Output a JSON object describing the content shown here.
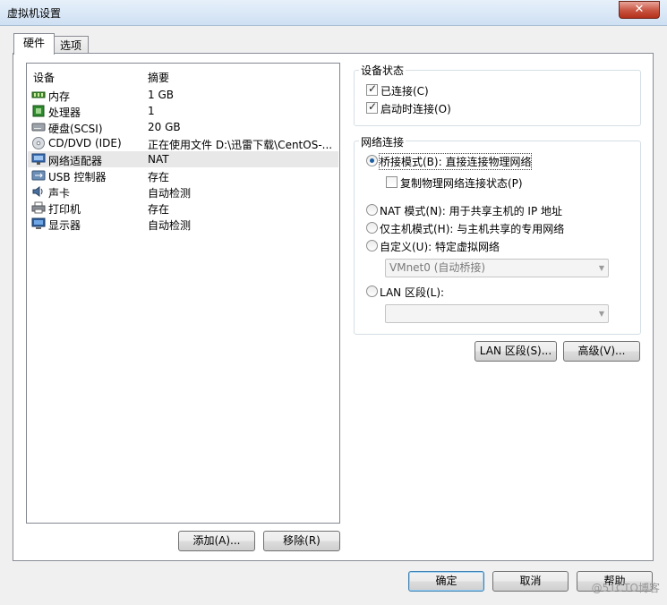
{
  "window": {
    "title": "虚拟机设置",
    "close_glyph": "✕"
  },
  "tabs": [
    {
      "label": "硬件"
    },
    {
      "label": "选项"
    }
  ],
  "device_list": {
    "col_device": "设备",
    "col_summary": "摘要",
    "rows": [
      {
        "name": "内存",
        "summary": "1 GB",
        "icon": "memory-icon"
      },
      {
        "name": "处理器",
        "summary": "1",
        "icon": "processor-icon"
      },
      {
        "name": "硬盘(SCSI)",
        "summary": "20 GB",
        "icon": "hard-disk-icon"
      },
      {
        "name": "CD/DVD (IDE)",
        "summary": "正在使用文件 D:\\迅雷下载\\CentOS-...",
        "icon": "cd-dvd-icon"
      },
      {
        "name": "网络适配器",
        "summary": "NAT",
        "icon": "network-adapter-icon",
        "selected": true
      },
      {
        "name": "USB 控制器",
        "summary": "存在",
        "icon": "usb-icon"
      },
      {
        "name": "声卡",
        "summary": "自动检测",
        "icon": "sound-card-icon"
      },
      {
        "name": "打印机",
        "summary": "存在",
        "icon": "printer-icon"
      },
      {
        "name": "显示器",
        "summary": "自动检测",
        "icon": "display-icon"
      }
    ]
  },
  "left_buttons": {
    "add": "添加(A)...",
    "remove": "移除(R)"
  },
  "device_status": {
    "title": "设备状态",
    "connected": {
      "label": "已连接(C)",
      "checked": true
    },
    "connect_at_power_on": {
      "label": "启动时连接(O)",
      "checked": true
    }
  },
  "network_connection": {
    "title": "网络连接",
    "bridged": {
      "label": "桥接模式(B): 直接连接物理网络",
      "selected": true
    },
    "replicate": {
      "label": "复制物理网络连接状态(P)",
      "checked": false
    },
    "nat": {
      "label": "NAT 模式(N): 用于共享主机的 IP 地址",
      "selected": false
    },
    "host_only": {
      "label": "仅主机模式(H): 与主机共享的专用网络",
      "selected": false
    },
    "custom": {
      "label": "自定义(U): 特定虚拟网络",
      "selected": false
    },
    "custom_combo": "VMnet0 (自动桥接)",
    "lan_segment": {
      "label": "LAN 区段(L):",
      "selected": false
    },
    "lan_combo": ""
  },
  "right_buttons": {
    "lan_segments": "LAN 区段(S)...",
    "advanced": "高级(V)..."
  },
  "footer": {
    "ok": "确定",
    "cancel": "取消",
    "help": "帮助"
  },
  "watermark": "@51CTO博客",
  "colors": {
    "selection": "#e8e8e8",
    "title_bar": "#cfe0f3",
    "close": "#c7523f"
  }
}
